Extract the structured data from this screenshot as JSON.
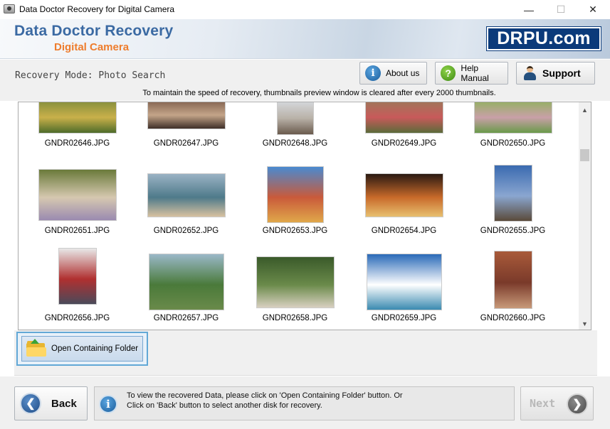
{
  "window": {
    "title": "Data Doctor Recovery for Digital Camera",
    "minimize": "—",
    "maximize": "☐",
    "close": "✕"
  },
  "banner": {
    "title": "Data Doctor Recovery",
    "subtitle": "Digital Camera",
    "brand": "DRPU.com"
  },
  "mode": {
    "label": "Recovery Mode: Photo Search"
  },
  "header_buttons": {
    "about": "About us",
    "help": "Help Manual",
    "support": "Support"
  },
  "notice": "To maintain the speed of recovery, thumbnails preview window is cleared after every 2000 thumbnails.",
  "thumbnails": [
    {
      "name": "GNDR02646.JPG",
      "colors": [
        "#7d8a3a",
        "#c9b04a",
        "#4e6b2a"
      ]
    },
    {
      "name": "GNDR02647.JPG",
      "colors": [
        "#7a5a48",
        "#c4a589",
        "#3e2e28"
      ]
    },
    {
      "name": "GNDR02648.JPG",
      "colors": [
        "#d9dde3",
        "#b9b2a8",
        "#6a5a4d"
      ]
    },
    {
      "name": "GNDR02649.JPG",
      "colors": [
        "#9a7a5a",
        "#c85a5a",
        "#5b6b3a"
      ]
    },
    {
      "name": "GNDR02650.JPG",
      "colors": [
        "#8db35a",
        "#c9a0a8",
        "#6a9a4a"
      ]
    },
    {
      "name": "GNDR02651.JPG",
      "colors": [
        "#6a7a3a",
        "#d6c8b0",
        "#9a8ab0"
      ]
    },
    {
      "name": "GNDR02652.JPG",
      "colors": [
        "#9ab2c4",
        "#4e7a8a",
        "#d8c2a0"
      ]
    },
    {
      "name": "GNDR02653.JPG",
      "colors": [
        "#4a8ad0",
        "#c95a3a",
        "#e0a84a"
      ]
    },
    {
      "name": "GNDR02654.JPG",
      "colors": [
        "#2a1a12",
        "#c86a2a",
        "#e8c070"
      ]
    },
    {
      "name": "GNDR02655.JPG",
      "colors": [
        "#3a6ab0",
        "#8aa6d0",
        "#5a4a3a"
      ]
    },
    {
      "name": "GNDR02656.JPG",
      "colors": [
        "#e8e8e8",
        "#b03030",
        "#4a4a5a"
      ]
    },
    {
      "name": "GNDR02657.JPG",
      "colors": [
        "#9ab8c8",
        "#4a7a3a",
        "#6a8a4a"
      ]
    },
    {
      "name": "GNDR02658.JPG",
      "colors": [
        "#3a5a2a",
        "#6a8a4a",
        "#d8d0c0"
      ]
    },
    {
      "name": "GNDR02659.JPG",
      "colors": [
        "#2a6ab8",
        "#ffffff",
        "#3a8ab0"
      ]
    },
    {
      "name": "GNDR02660.JPG",
      "colors": [
        "#a85a3a",
        "#7a3a2a",
        "#c89a7a"
      ]
    }
  ],
  "scrollbar": {
    "up": "▲",
    "down": "▼"
  },
  "open_folder_button": "Open Containing Folder",
  "back_button": "Back",
  "info_text_line1": "To view the recovered Data, please click on 'Open Containing Folder' button. Or",
  "info_text_line2": "Click on 'Back' button to select another disk for recovery.",
  "next_button": "Next"
}
